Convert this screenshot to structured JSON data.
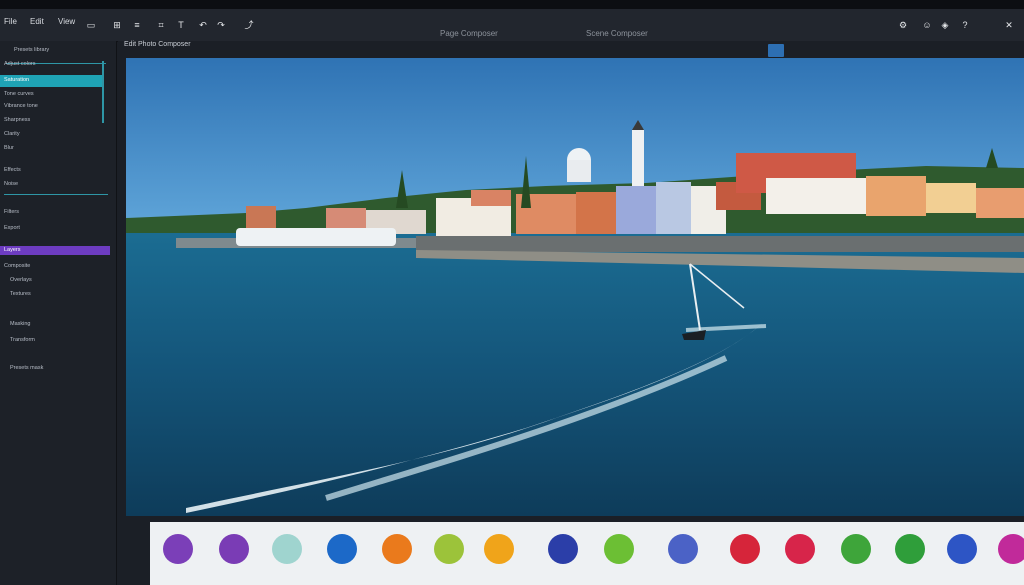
{
  "toolbar": {
    "left_items": [
      "File",
      "Edit",
      "View"
    ],
    "center_label_1": "Page Composer",
    "center_label_2": "Scene Composer",
    "icons": [
      "align-icon",
      "grid-icon",
      "layers-icon",
      "crop-icon",
      "text-icon",
      "undo-icon",
      "redo-icon",
      "share-icon",
      "settings-icon",
      "user-icon",
      "help-icon"
    ]
  },
  "main_header": {
    "title": "Edit Photo Composer"
  },
  "sidebar": {
    "items": [
      {
        "label": "Presets library"
      },
      {
        "label": "Adjust colors"
      },
      {
        "label": "Saturation"
      },
      {
        "label": "Tone curves"
      },
      {
        "label": "Vibrance tone"
      },
      {
        "label": "Sharpness"
      },
      {
        "label": "Clarity"
      },
      {
        "label": "Blur"
      },
      {
        "label": "Effects"
      },
      {
        "label": "Noise"
      },
      {
        "label": "Filters"
      },
      {
        "label": "Export"
      },
      {
        "label": "Layers"
      },
      {
        "label": "Composite"
      },
      {
        "label": "Overlays"
      },
      {
        "label": "Textures"
      },
      {
        "label": "Masking"
      },
      {
        "label": "Transform"
      },
      {
        "label": "Presets mask"
      }
    ]
  },
  "palette": {
    "swatches": [
      "#7b3fb8",
      "#7a3cb5",
      "#9fd4cf",
      "#1c69c8",
      "#ea7a1c",
      "#9cc33a",
      "#f0a41a",
      "#2b3ea8",
      "#6cbf34",
      "#4b62c6",
      "#d6253a",
      "#d7254a",
      "#3ea53a",
      "#2f9e3a",
      "#2d55c5",
      "#c12a9a"
    ]
  }
}
